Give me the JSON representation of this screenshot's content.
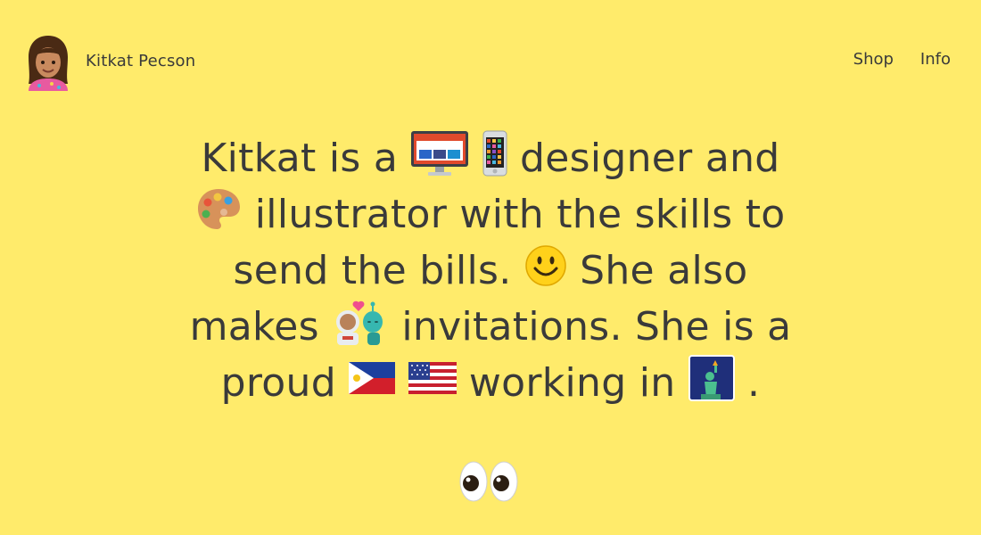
{
  "header": {
    "name": "Kitkat Pecson",
    "nav": [
      {
        "label": "Shop"
      },
      {
        "label": "Info"
      }
    ]
  },
  "intro": {
    "seg1": "Kitkat is a ",
    "seg2": " designer and ",
    "seg3": " illustrator with the skills to send the bills. ",
    "seg4": " She also makes ",
    "seg5": " invitations. She is a proud ",
    "seg6": " working in ",
    "seg7": "."
  },
  "icons": {
    "avatar": "woman-emoji",
    "desktop": "desktop-computer-emoji",
    "phone": "mobile-phone-emoji",
    "palette": "artist-palette-emoji",
    "smile": "smiling-face-emoji",
    "couple": "astronaut-and-alien-couple-emoji",
    "flag_ph": "philippines-flag-emoji",
    "flag_us": "united-states-flag-emoji",
    "liberty": "statue-of-liberty-emoji",
    "eyes": "eyes-emoji"
  },
  "colors": {
    "background": "#FFEB6B",
    "text": "#3a3a3a"
  }
}
